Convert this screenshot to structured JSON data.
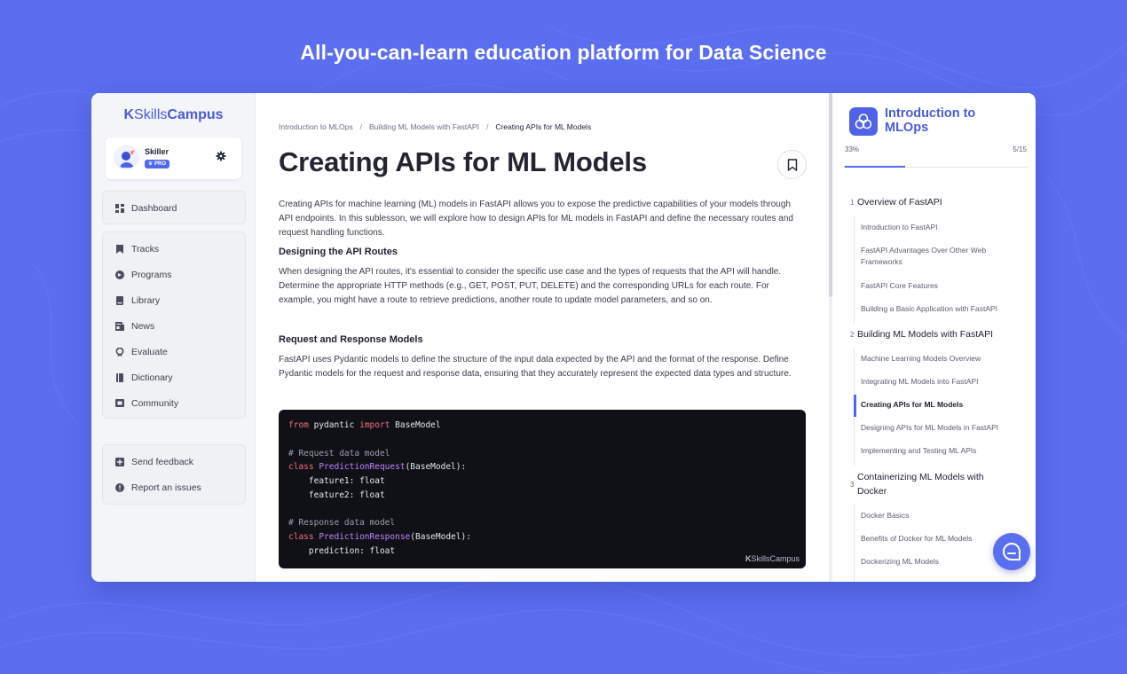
{
  "headline": "All-you-can-learn education platform for Data Science",
  "colors": {
    "background": "#5b6ef0",
    "brand": "#4b5bd6",
    "accent": "#5267f0",
    "code_bg": "#0f1117"
  },
  "logo": {
    "k": "K",
    "skills": "Skills",
    "campus": "Campus"
  },
  "user": {
    "name": "Skiller",
    "badge": "PRO"
  },
  "nav": {
    "dashboard": "Dashboard",
    "items": [
      "Tracks",
      "Programs",
      "Library",
      "News",
      "Evaluate",
      "Dictionary",
      "Community"
    ],
    "support": [
      "Send feedback",
      "Report an issues"
    ]
  },
  "icons": [
    "gear-icon",
    "dashboard-icon",
    "tracks-icon",
    "programs-icon",
    "library-icon",
    "news-icon",
    "evaluate-icon",
    "dictionary-icon",
    "community-icon",
    "feedback-icon",
    "report-icon",
    "bookmark-icon",
    "course-icon",
    "chat-icon"
  ],
  "breadcrumb": [
    "Introduction to MLOps",
    "Building ML Models with FastAPI",
    "Creating APIs for ML Models"
  ],
  "breadcrumb_sep": "/",
  "lesson": {
    "title": "Creating APIs for ML Models",
    "intro": "Creating APIs for machine learning (ML) models in FastAPI allows you to expose the predictive capabilities of your models through API endpoints. In this sublesson, we will explore how to design APIs for ML models in FastAPI and define the necessary routes and request handling functions.",
    "h1": "Designing the API Routes",
    "p1": "When designing the API routes, it's essential to consider the specific use case and the types of requests that the API will handle. Determine the appropriate HTTP methods (e.g., GET, POST, PUT, DELETE) and the corresponding URLs for each route. For example, you might have a route to retrieve predictions, another route to update model parameters, and so on.",
    "h2": "Request and Response Models",
    "p2": "FastAPI uses Pydantic models to define the structure of the input data expected by the API and the format of the response. Define Pydantic models for the request and response data, ensuring that they accurately represent the expected data types and structure."
  },
  "code": {
    "l1_kw1": "from",
    "l1_mid": " pydantic ",
    "l1_kw2": "import",
    "l1_end": " BaseModel",
    "c1": "# Request data model",
    "l2_kw": "class",
    "l2_cls": " PredictionRequest",
    "l2_end": "(BaseModel):",
    "f1": "    feature1: float",
    "f2": "    feature2: float",
    "c2": "# Response data model",
    "l3_kw": "class",
    "l3_cls": " PredictionResponse",
    "l3_end": "(BaseModel):",
    "f3": "    prediction: float",
    "brand": "SkillsCampus"
  },
  "course": {
    "title": "Introduction to MLOps",
    "progress_label": "33%",
    "progress_fraction": 0.33,
    "count": "5/15",
    "sections": [
      {
        "num": "1",
        "title": "Overview of FastAPI",
        "lessons": [
          "Introduction to FastAPI",
          "FastAPI Advantages Over Other Web Frameworks",
          "FastAPI Core Features",
          "Building a Basic Application with FastAPI"
        ]
      },
      {
        "num": "2",
        "title": "Building ML Models with FastAPI",
        "lessons": [
          "Machine Learning Models Overview",
          "Integrating ML Models into FastAPI",
          "Creating APIs for ML Models",
          "Designing APIs for ML Models in FastAPI",
          "Implementing and Testing ML APIs"
        ]
      },
      {
        "num": "3",
        "title": "Containerizing ML Models with Docker",
        "lessons": [
          "Docker Basics",
          "Benefits of Docker for ML Models",
          "Dockerizing ML Models"
        ]
      }
    ]
  }
}
